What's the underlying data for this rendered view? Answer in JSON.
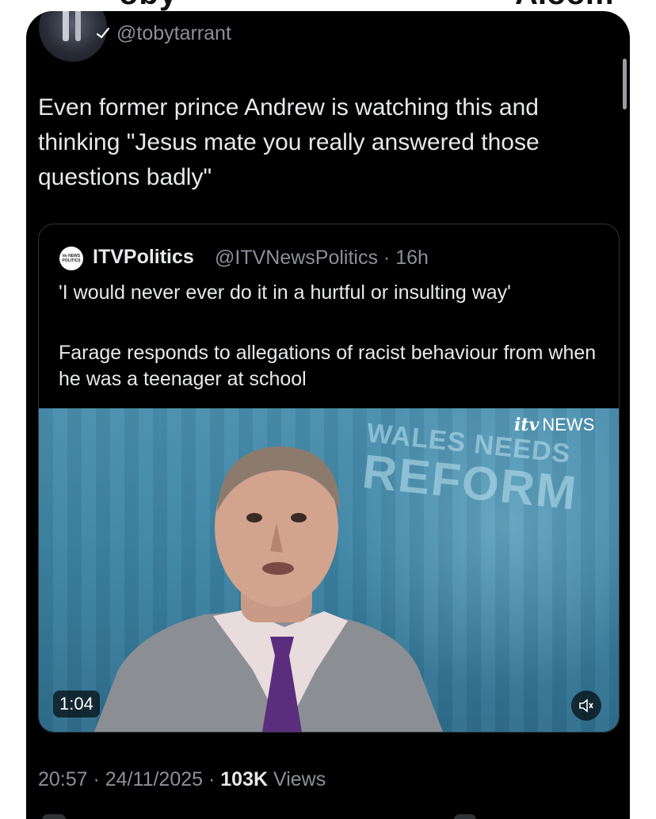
{
  "header": {
    "handle": "@tobytarrant"
  },
  "tweet": {
    "text": "Even former prince Andrew is watching this and thinking \"Jesus mate you really answered those questions badly\""
  },
  "quoted_tweet": {
    "avatar_label_line1": "itv NEWS",
    "avatar_label_line2": "POLITICS",
    "name": "ITVPolitics",
    "handle": "@ITVNewsPolitics",
    "age": "16h",
    "quote_line": "'I would never ever do it in a hurtful or insulting way'",
    "body": "Farage responds to allegations of racist behaviour from when he was a teenager at school",
    "video": {
      "brand_mark": "itv",
      "brand_text": "NEWS",
      "backdrop_line1": "WALES NEEDS",
      "backdrop_line2": "REFORM",
      "duration": "1:04"
    }
  },
  "meta": {
    "time": "20:57",
    "date": "24/11/2025",
    "views_count": "103K",
    "views_label": "Views"
  }
}
